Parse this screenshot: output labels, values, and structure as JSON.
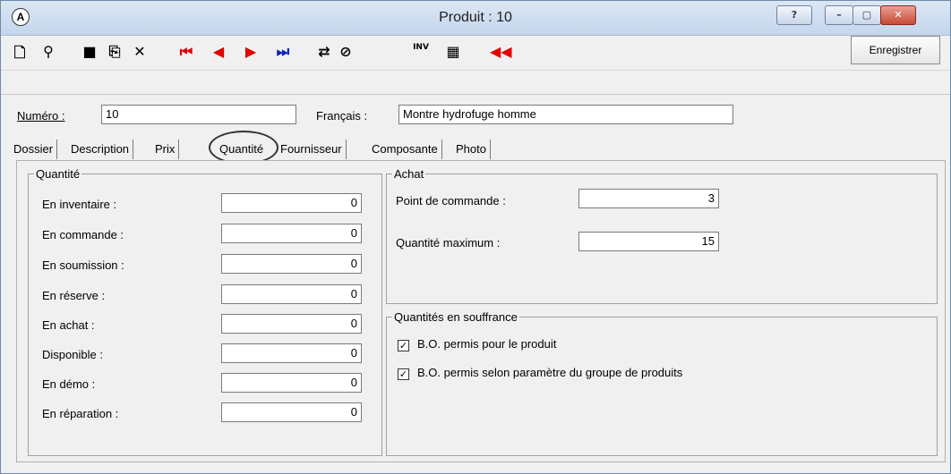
{
  "window": {
    "title": "Produit : 10",
    "caption_buttons": [
      "?",
      "–",
      "▢",
      "✕"
    ]
  },
  "toolbar": {
    "icons": [
      "new-icon",
      "find-icon",
      "save-icon",
      "copy-icon",
      "delete-icon",
      "first-icon",
      "prev-icon",
      "next-icon",
      "last-icon",
      "sync-icon",
      "cancel-icon",
      "inventory-icon",
      "grid-icon",
      "back-icon"
    ],
    "save_label": "Enregistrer"
  },
  "header": {
    "numero_label": "Numéro :",
    "numero_value": "10",
    "francais_label": "Français :",
    "francais_value": "Montre hydrofuge homme"
  },
  "tabs": [
    "Dossier",
    "Description",
    "Prix",
    "Quantité",
    "Fournisseur",
    "Composante",
    "Photo"
  ],
  "quantite_group": {
    "title": "Quantité",
    "rows": [
      {
        "label": "En inventaire :",
        "value": "0"
      },
      {
        "label": "En commande :",
        "value": "0"
      },
      {
        "label": "En soumission :",
        "value": "0"
      },
      {
        "label": "En réserve :",
        "value": "0"
      },
      {
        "label": "En achat :",
        "value": "0"
      },
      {
        "label": "Disponible :",
        "value": "0"
      },
      {
        "label": "En démo :",
        "value": "0"
      },
      {
        "label": "En réparation :",
        "value": "0"
      }
    ]
  },
  "achat_group": {
    "title": "Achat",
    "point_label": "Point de commande :",
    "point_value": "3",
    "max_label": "Quantité maximum :",
    "max_value": "15"
  },
  "souffrance_group": {
    "title": "Quantités en souffrance",
    "bo_produit": "B.O. permis pour le produit",
    "bo_groupe": "B.O. permis selon paramètre du groupe de produits"
  }
}
